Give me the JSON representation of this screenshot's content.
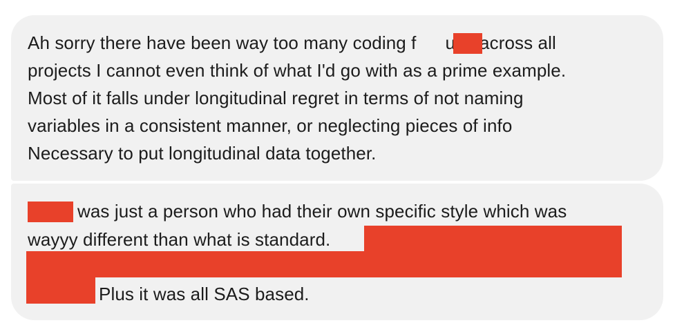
{
  "messages": [
    {
      "lines": [
        {
          "before": "Ah sorry there have been way too many coding f",
          "after": "ups across all"
        },
        "projects I cannot even think of what I'd go with as a prime example.",
        "Most of it falls under longitudinal regret in terms of not naming",
        "variables in a consistent manner, or neglecting pieces of info",
        "Necessary to put longitudinal data together."
      ]
    },
    {
      "lines": [
        "was just a person who had their own specific style which was",
        "wayyy different than what is standard.",
        "Plus it was all SAS based."
      ]
    }
  ],
  "colors": {
    "bubble_background": "#f1f1f1",
    "text": "#1c1c1c",
    "redaction": "#e8412a"
  }
}
